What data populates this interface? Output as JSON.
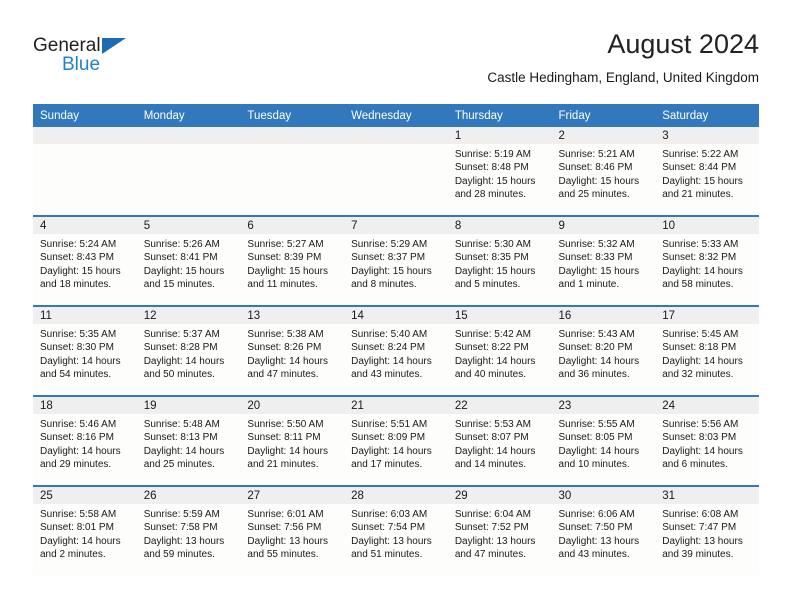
{
  "brand": {
    "name_top": "General",
    "name_bottom": "Blue",
    "triangle_color": "#1b6cb5",
    "blue_color": "#2383c4"
  },
  "header": {
    "month_title": "August 2024",
    "location": "Castle Hedingham, England, United Kingdom"
  },
  "theme": {
    "header_blue": "#3178bd",
    "daynum_band": "#efefef",
    "cell_bg": "#fdfdfc"
  },
  "weekdays": [
    "Sunday",
    "Monday",
    "Tuesday",
    "Wednesday",
    "Thursday",
    "Friday",
    "Saturday"
  ],
  "weeks": [
    [
      {
        "day": "",
        "lines": []
      },
      {
        "day": "",
        "lines": []
      },
      {
        "day": "",
        "lines": []
      },
      {
        "day": "",
        "lines": []
      },
      {
        "day": "1",
        "lines": [
          "Sunrise: 5:19 AM",
          "Sunset: 8:48 PM",
          "Daylight: 15 hours",
          "and 28 minutes."
        ]
      },
      {
        "day": "2",
        "lines": [
          "Sunrise: 5:21 AM",
          "Sunset: 8:46 PM",
          "Daylight: 15 hours",
          "and 25 minutes."
        ]
      },
      {
        "day": "3",
        "lines": [
          "Sunrise: 5:22 AM",
          "Sunset: 8:44 PM",
          "Daylight: 15 hours",
          "and 21 minutes."
        ]
      }
    ],
    [
      {
        "day": "4",
        "lines": [
          "Sunrise: 5:24 AM",
          "Sunset: 8:43 PM",
          "Daylight: 15 hours",
          "and 18 minutes."
        ]
      },
      {
        "day": "5",
        "lines": [
          "Sunrise: 5:26 AM",
          "Sunset: 8:41 PM",
          "Daylight: 15 hours",
          "and 15 minutes."
        ]
      },
      {
        "day": "6",
        "lines": [
          "Sunrise: 5:27 AM",
          "Sunset: 8:39 PM",
          "Daylight: 15 hours",
          "and 11 minutes."
        ]
      },
      {
        "day": "7",
        "lines": [
          "Sunrise: 5:29 AM",
          "Sunset: 8:37 PM",
          "Daylight: 15 hours",
          "and 8 minutes."
        ]
      },
      {
        "day": "8",
        "lines": [
          "Sunrise: 5:30 AM",
          "Sunset: 8:35 PM",
          "Daylight: 15 hours",
          "and 5 minutes."
        ]
      },
      {
        "day": "9",
        "lines": [
          "Sunrise: 5:32 AM",
          "Sunset: 8:33 PM",
          "Daylight: 15 hours",
          "and 1 minute."
        ]
      },
      {
        "day": "10",
        "lines": [
          "Sunrise: 5:33 AM",
          "Sunset: 8:32 PM",
          "Daylight: 14 hours",
          "and 58 minutes."
        ]
      }
    ],
    [
      {
        "day": "11",
        "lines": [
          "Sunrise: 5:35 AM",
          "Sunset: 8:30 PM",
          "Daylight: 14 hours",
          "and 54 minutes."
        ]
      },
      {
        "day": "12",
        "lines": [
          "Sunrise: 5:37 AM",
          "Sunset: 8:28 PM",
          "Daylight: 14 hours",
          "and 50 minutes."
        ]
      },
      {
        "day": "13",
        "lines": [
          "Sunrise: 5:38 AM",
          "Sunset: 8:26 PM",
          "Daylight: 14 hours",
          "and 47 minutes."
        ]
      },
      {
        "day": "14",
        "lines": [
          "Sunrise: 5:40 AM",
          "Sunset: 8:24 PM",
          "Daylight: 14 hours",
          "and 43 minutes."
        ]
      },
      {
        "day": "15",
        "lines": [
          "Sunrise: 5:42 AM",
          "Sunset: 8:22 PM",
          "Daylight: 14 hours",
          "and 40 minutes."
        ]
      },
      {
        "day": "16",
        "lines": [
          "Sunrise: 5:43 AM",
          "Sunset: 8:20 PM",
          "Daylight: 14 hours",
          "and 36 minutes."
        ]
      },
      {
        "day": "17",
        "lines": [
          "Sunrise: 5:45 AM",
          "Sunset: 8:18 PM",
          "Daylight: 14 hours",
          "and 32 minutes."
        ]
      }
    ],
    [
      {
        "day": "18",
        "lines": [
          "Sunrise: 5:46 AM",
          "Sunset: 8:16 PM",
          "Daylight: 14 hours",
          "and 29 minutes."
        ]
      },
      {
        "day": "19",
        "lines": [
          "Sunrise: 5:48 AM",
          "Sunset: 8:13 PM",
          "Daylight: 14 hours",
          "and 25 minutes."
        ]
      },
      {
        "day": "20",
        "lines": [
          "Sunrise: 5:50 AM",
          "Sunset: 8:11 PM",
          "Daylight: 14 hours",
          "and 21 minutes."
        ]
      },
      {
        "day": "21",
        "lines": [
          "Sunrise: 5:51 AM",
          "Sunset: 8:09 PM",
          "Daylight: 14 hours",
          "and 17 minutes."
        ]
      },
      {
        "day": "22",
        "lines": [
          "Sunrise: 5:53 AM",
          "Sunset: 8:07 PM",
          "Daylight: 14 hours",
          "and 14 minutes."
        ]
      },
      {
        "day": "23",
        "lines": [
          "Sunrise: 5:55 AM",
          "Sunset: 8:05 PM",
          "Daylight: 14 hours",
          "and 10 minutes."
        ]
      },
      {
        "day": "24",
        "lines": [
          "Sunrise: 5:56 AM",
          "Sunset: 8:03 PM",
          "Daylight: 14 hours",
          "and 6 minutes."
        ]
      }
    ],
    [
      {
        "day": "25",
        "lines": [
          "Sunrise: 5:58 AM",
          "Sunset: 8:01 PM",
          "Daylight: 14 hours",
          "and 2 minutes."
        ]
      },
      {
        "day": "26",
        "lines": [
          "Sunrise: 5:59 AM",
          "Sunset: 7:58 PM",
          "Daylight: 13 hours",
          "and 59 minutes."
        ]
      },
      {
        "day": "27",
        "lines": [
          "Sunrise: 6:01 AM",
          "Sunset: 7:56 PM",
          "Daylight: 13 hours",
          "and 55 minutes."
        ]
      },
      {
        "day": "28",
        "lines": [
          "Sunrise: 6:03 AM",
          "Sunset: 7:54 PM",
          "Daylight: 13 hours",
          "and 51 minutes."
        ]
      },
      {
        "day": "29",
        "lines": [
          "Sunrise: 6:04 AM",
          "Sunset: 7:52 PM",
          "Daylight: 13 hours",
          "and 47 minutes."
        ]
      },
      {
        "day": "30",
        "lines": [
          "Sunrise: 6:06 AM",
          "Sunset: 7:50 PM",
          "Daylight: 13 hours",
          "and 43 minutes."
        ]
      },
      {
        "day": "31",
        "lines": [
          "Sunrise: 6:08 AM",
          "Sunset: 7:47 PM",
          "Daylight: 13 hours",
          "and 39 minutes."
        ]
      }
    ]
  ]
}
